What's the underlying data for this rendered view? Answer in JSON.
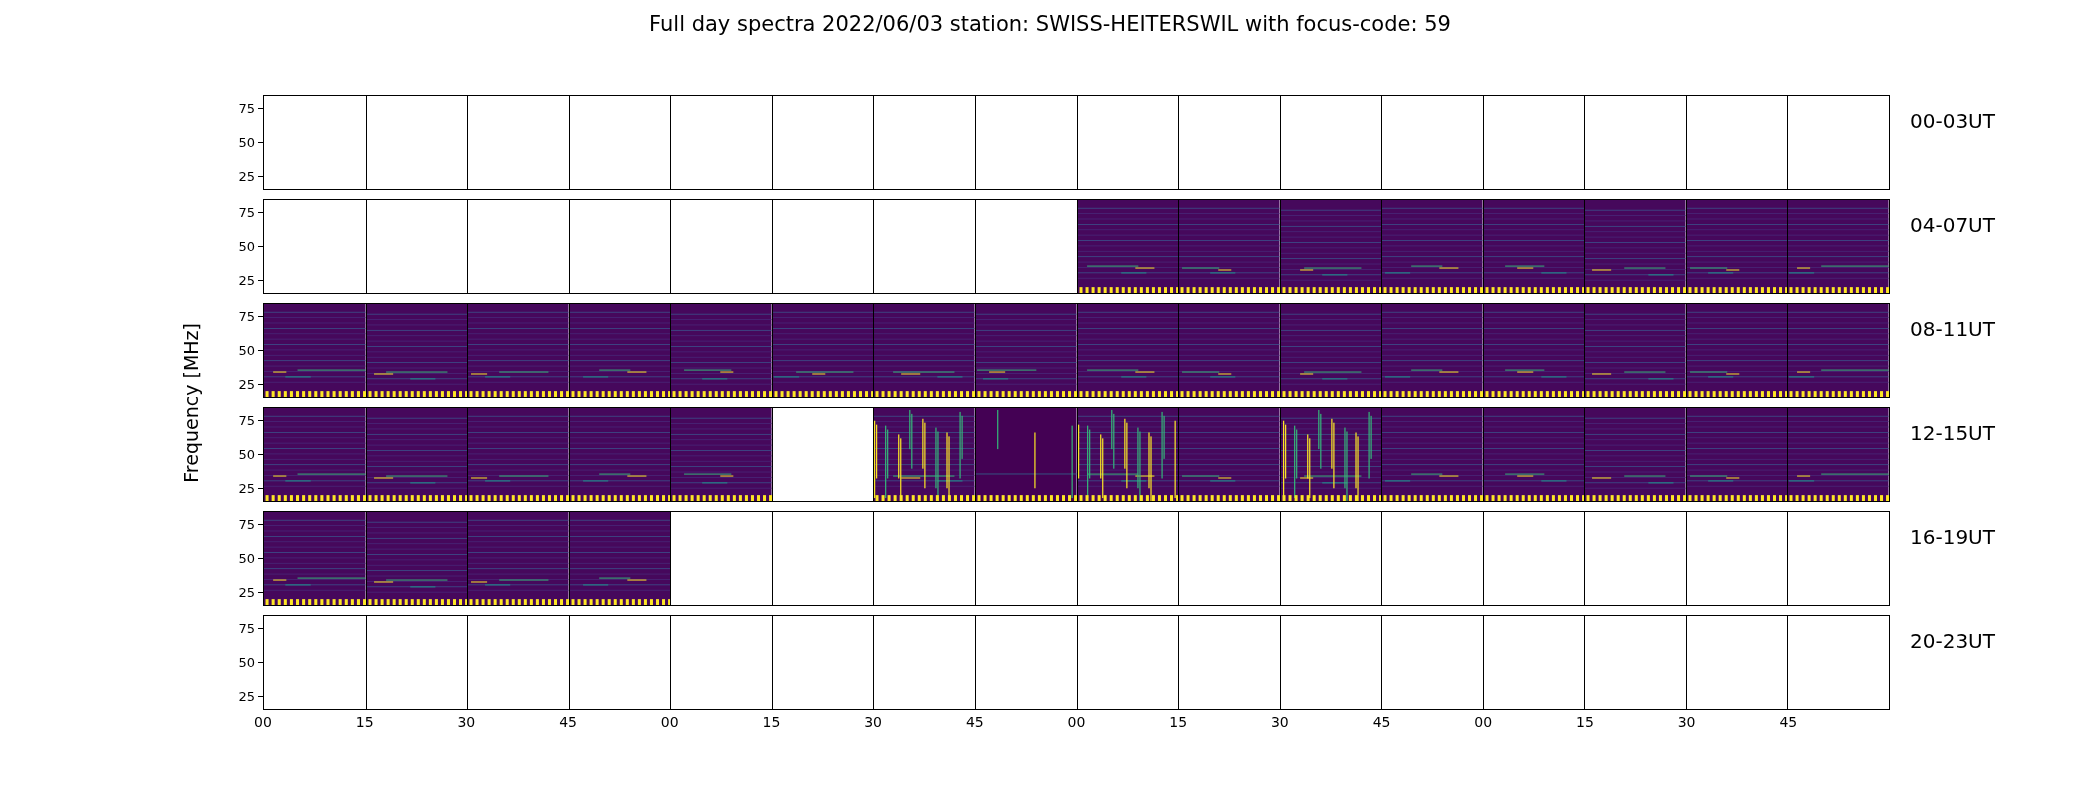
{
  "title": "Full day spectra 2022/06/03 station: SWISS-HEITERSWIL with focus-code: 59",
  "ylabel": "Frequency [MHz]",
  "rows": [
    {
      "label": "00-03UT",
      "yticks": [
        "75",
        "50",
        "25"
      ],
      "panels": [
        {
          "kind": "empty"
        },
        {
          "kind": "empty"
        },
        {
          "kind": "empty"
        },
        {
          "kind": "empty"
        },
        {
          "kind": "empty"
        },
        {
          "kind": "empty"
        },
        {
          "kind": "empty"
        },
        {
          "kind": "empty"
        },
        {
          "kind": "empty"
        },
        {
          "kind": "empty"
        },
        {
          "kind": "empty"
        },
        {
          "kind": "empty"
        },
        {
          "kind": "empty"
        },
        {
          "kind": "empty"
        },
        {
          "kind": "empty"
        },
        {
          "kind": "empty"
        }
      ]
    },
    {
      "label": "04-07UT",
      "yticks": [
        "75",
        "50",
        "25"
      ],
      "panels": [
        {
          "kind": "empty"
        },
        {
          "kind": "empty"
        },
        {
          "kind": "empty"
        },
        {
          "kind": "empty"
        },
        {
          "kind": "empty"
        },
        {
          "kind": "empty"
        },
        {
          "kind": "empty"
        },
        {
          "kind": "empty"
        },
        {
          "kind": "spectrum"
        },
        {
          "kind": "spectrum"
        },
        {
          "kind": "spectrum"
        },
        {
          "kind": "spectrum"
        },
        {
          "kind": "spectrum"
        },
        {
          "kind": "spectrum"
        },
        {
          "kind": "spectrum"
        },
        {
          "kind": "spectrum"
        }
      ]
    },
    {
      "label": "08-11UT",
      "yticks": [
        "75",
        "50",
        "25"
      ],
      "panels": [
        {
          "kind": "spectrum"
        },
        {
          "kind": "spectrum"
        },
        {
          "kind": "spectrum"
        },
        {
          "kind": "spectrum"
        },
        {
          "kind": "spectrum"
        },
        {
          "kind": "spectrum"
        },
        {
          "kind": "spectrum"
        },
        {
          "kind": "spectrum"
        },
        {
          "kind": "spectrum"
        },
        {
          "kind": "spectrum"
        },
        {
          "kind": "spectrum"
        },
        {
          "kind": "spectrum"
        },
        {
          "kind": "spectrum"
        },
        {
          "kind": "spectrum"
        },
        {
          "kind": "spectrum"
        },
        {
          "kind": "spectrum"
        }
      ]
    },
    {
      "label": "12-15UT",
      "yticks": [
        "75",
        "50",
        "25"
      ],
      "panels": [
        {
          "kind": "spectrum"
        },
        {
          "kind": "spectrum"
        },
        {
          "kind": "spectrum"
        },
        {
          "kind": "spectrum"
        },
        {
          "kind": "spectrum"
        },
        {
          "kind": "empty"
        },
        {
          "kind": "burst"
        },
        {
          "kind": "quiet"
        },
        {
          "kind": "burst"
        },
        {
          "kind": "spectrum"
        },
        {
          "kind": "burst"
        },
        {
          "kind": "spectrum"
        },
        {
          "kind": "spectrum"
        },
        {
          "kind": "spectrum"
        },
        {
          "kind": "spectrum"
        },
        {
          "kind": "spectrum"
        }
      ]
    },
    {
      "label": "16-19UT",
      "yticks": [
        "75",
        "50",
        "25"
      ],
      "panels": [
        {
          "kind": "spectrum"
        },
        {
          "kind": "spectrum"
        },
        {
          "kind": "spectrum"
        },
        {
          "kind": "spectrum"
        },
        {
          "kind": "empty"
        },
        {
          "kind": "empty"
        },
        {
          "kind": "empty"
        },
        {
          "kind": "empty"
        },
        {
          "kind": "empty"
        },
        {
          "kind": "empty"
        },
        {
          "kind": "empty"
        },
        {
          "kind": "empty"
        },
        {
          "kind": "empty"
        },
        {
          "kind": "empty"
        },
        {
          "kind": "empty"
        },
        {
          "kind": "empty"
        }
      ]
    },
    {
      "label": "20-23UT",
      "yticks": [
        "75",
        "50",
        "25"
      ],
      "panels": [
        {
          "kind": "empty"
        },
        {
          "kind": "empty"
        },
        {
          "kind": "empty"
        },
        {
          "kind": "empty"
        },
        {
          "kind": "empty"
        },
        {
          "kind": "empty"
        },
        {
          "kind": "empty"
        },
        {
          "kind": "empty"
        },
        {
          "kind": "empty"
        },
        {
          "kind": "empty"
        },
        {
          "kind": "empty"
        },
        {
          "kind": "empty"
        },
        {
          "kind": "empty"
        },
        {
          "kind": "empty"
        },
        {
          "kind": "empty"
        },
        {
          "kind": "empty"
        }
      ]
    }
  ],
  "xticks": [
    "00",
    "15",
    "30",
    "45",
    "00",
    "15",
    "30",
    "45",
    "00",
    "15",
    "30",
    "45",
    "00",
    "15",
    "30",
    "45"
  ]
}
